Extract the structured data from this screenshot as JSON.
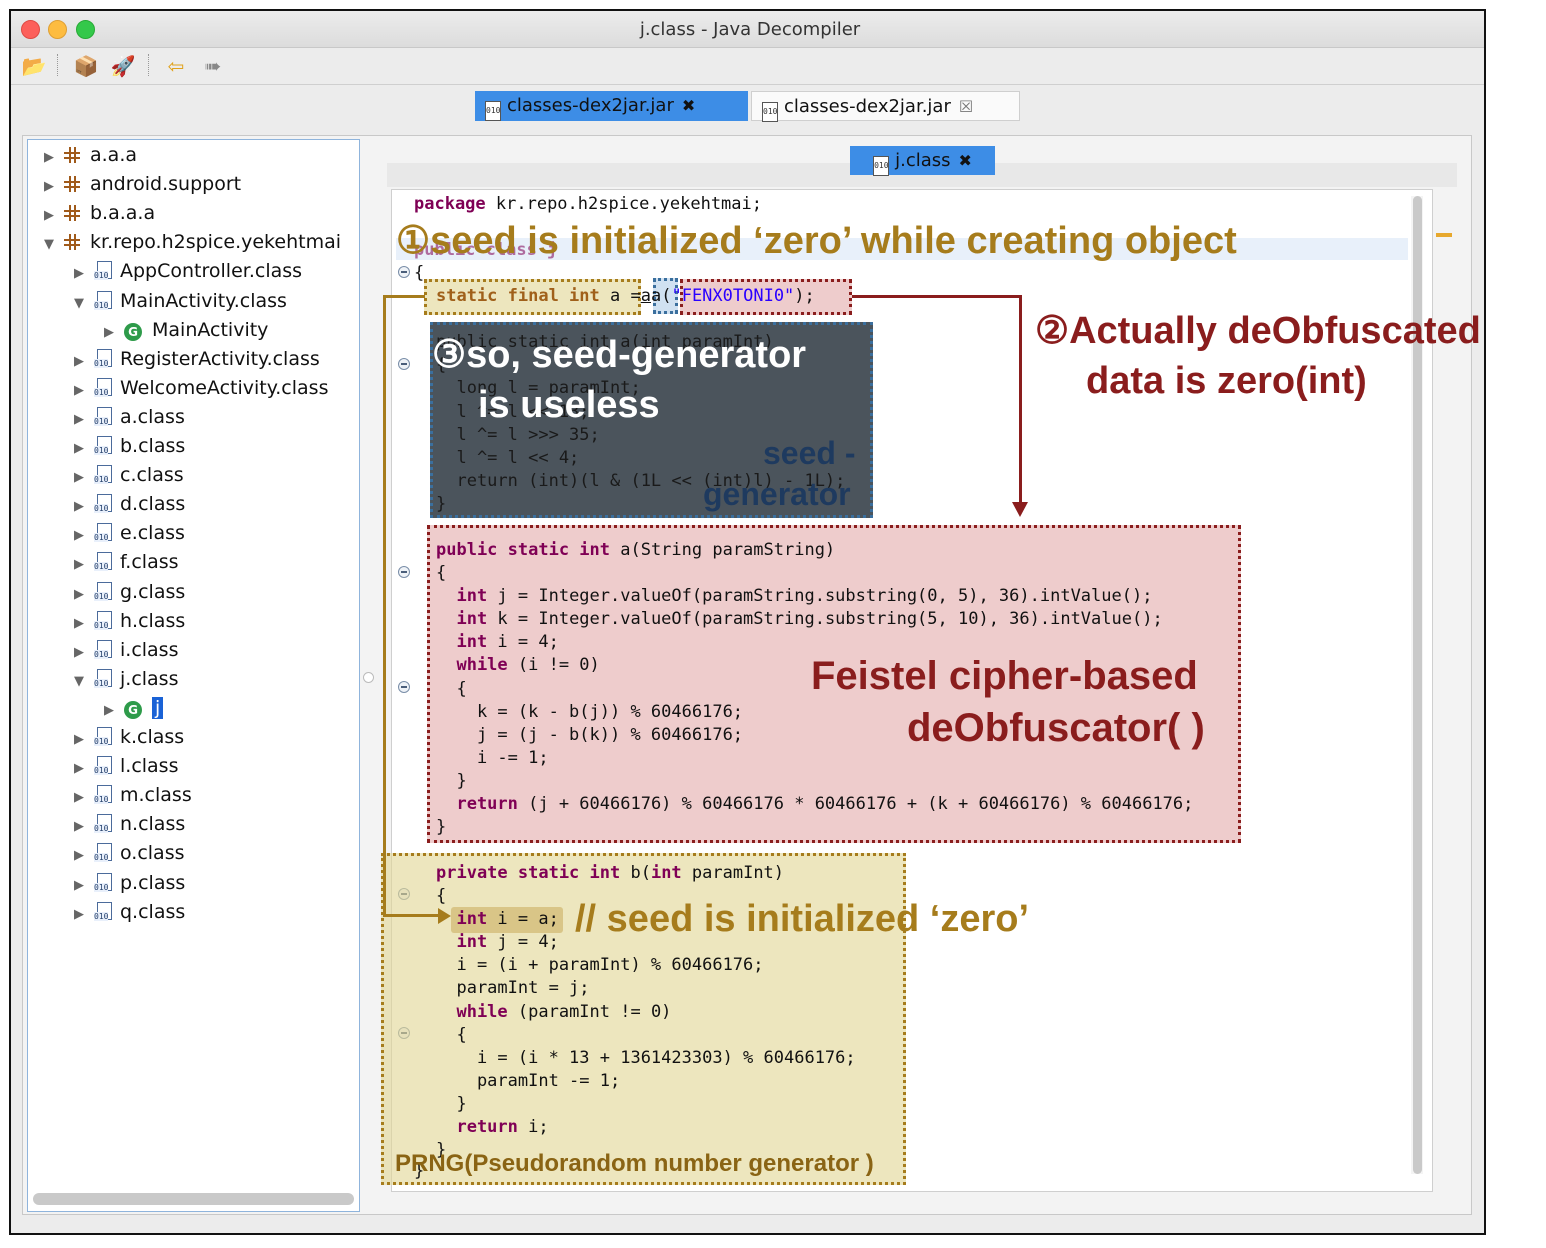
{
  "window": {
    "title": "j.class - Java Decompiler"
  },
  "toolbar": {
    "icons": [
      "open-folder-icon",
      "open-type-icon",
      "rocket-icon",
      "back-arrow-icon",
      "forward-arrow-icon"
    ]
  },
  "jar_tabs": [
    {
      "label": "classes-dex2jar.jar",
      "active": true,
      "close": "✖"
    },
    {
      "label": "classes-dex2jar.jar",
      "active": false,
      "close": "☒"
    }
  ],
  "tree": {
    "items": [
      {
        "label": "a.a.a",
        "type": "package",
        "expanded": false
      },
      {
        "label": "android.support",
        "type": "package",
        "expanded": false
      },
      {
        "label": "b.a.a.a",
        "type": "package",
        "expanded": false
      },
      {
        "label": "kr.repo.h2spice.yekehtmai",
        "type": "package",
        "expanded": true
      },
      {
        "label": "AppController.class",
        "type": "class",
        "expanded": false
      },
      {
        "label": "MainActivity.class",
        "type": "class",
        "expanded": true
      },
      {
        "label": "MainActivity",
        "type": "type",
        "expanded": false
      },
      {
        "label": "RegisterActivity.class",
        "type": "class",
        "expanded": false
      },
      {
        "label": "WelcomeActivity.class",
        "type": "class",
        "expanded": false
      },
      {
        "label": "a.class",
        "type": "class",
        "expanded": false
      },
      {
        "label": "b.class",
        "type": "class",
        "expanded": false
      },
      {
        "label": "c.class",
        "type": "class",
        "expanded": false
      },
      {
        "label": "d.class",
        "type": "class",
        "expanded": false
      },
      {
        "label": "e.class",
        "type": "class",
        "expanded": false
      },
      {
        "label": "f.class",
        "type": "class",
        "expanded": false
      },
      {
        "label": "g.class",
        "type": "class",
        "expanded": false
      },
      {
        "label": "h.class",
        "type": "class",
        "expanded": false
      },
      {
        "label": "i.class",
        "type": "class",
        "expanded": false
      },
      {
        "label": "j.class",
        "type": "class",
        "expanded": true
      },
      {
        "label": "j",
        "type": "type",
        "expanded": false,
        "selected": true
      },
      {
        "label": "k.class",
        "type": "class",
        "expanded": false
      },
      {
        "label": "l.class",
        "type": "class",
        "expanded": false
      },
      {
        "label": "m.class",
        "type": "class",
        "expanded": false
      },
      {
        "label": "n.class",
        "type": "class",
        "expanded": false
      },
      {
        "label": "o.class",
        "type": "class",
        "expanded": false
      },
      {
        "label": "p.class",
        "type": "class",
        "expanded": false
      },
      {
        "label": "q.class",
        "type": "class",
        "expanded": false
      }
    ]
  },
  "editor_tab": {
    "label": "j.class",
    "close": "✖"
  },
  "code": {
    "package_kw": "package",
    "package_name": " kr.repo.h2spice.yekehtmai;",
    "class_decl": "public class j",
    "open_brace": "{",
    "field_kw": "static final int",
    "field_name": " a ",
    "field_eq": "=",
    "field_call_a": "a",
    "field_call_rest": "a(",
    "field_string": "\"FENX0TONI0\"",
    "field_end": ");",
    "seedgen": [
      "public static int a(int paramInt)",
      "{",
      "  long l = paramInt;",
      "  l ^= l << 13;",
      "  l ^= l >>> 35;",
      "  l ^= l << 4;",
      "  return (int)(l & (1L << (int)l) - 1L);",
      "}"
    ],
    "deobf_sig_kw": "public static int",
    "deobf_sig_rest": " a(String paramString)",
    "deobf_lines": [
      {
        "kw": "",
        "text": "{"
      },
      {
        "kw": "  int",
        "text": " j = Integer.valueOf(paramString.substring(0, 5), 36).intValue();"
      },
      {
        "kw": "  int",
        "text": " k = Integer.valueOf(paramString.substring(5, 10), 36).intValue();"
      },
      {
        "kw": "  int",
        "text": " i = 4;"
      },
      {
        "kw": "  while",
        "text": " (i != 0)"
      },
      {
        "kw": "",
        "text": "  {"
      },
      {
        "kw": "",
        "text": "    k = (k - b(j)) % 60466176;"
      },
      {
        "kw": "",
        "text": "    j = (j - b(k)) % 60466176;"
      },
      {
        "kw": "",
        "text": "    i -= 1;"
      },
      {
        "kw": "",
        "text": "  }"
      },
      {
        "kw": "  return",
        "text": " (j + 60466176) % 60466176 * 60466176 + (k + 60466176) % 60466176;"
      },
      {
        "kw": "",
        "text": "}"
      }
    ],
    "prng_sig_kw": "private static int",
    "prng_sig_mid": " b(",
    "prng_sig_kw2": "int",
    "prng_sig_rest": " paramInt)",
    "prng_lines": [
      {
        "kw": "",
        "text": "{"
      },
      {
        "kw": "  int",
        "text": " i = a;"
      },
      {
        "kw": "  int",
        "text": " j = 4;"
      },
      {
        "kw": "",
        "text": "  i = (i + paramInt) % 60466176;"
      },
      {
        "kw": "",
        "text": "  paramInt = j;"
      },
      {
        "kw": "  while",
        "text": " (paramInt != 0)"
      },
      {
        "kw": "",
        "text": "  {"
      },
      {
        "kw": "",
        "text": "    i = (i * 13 + 1361423303) % 60466176;"
      },
      {
        "kw": "",
        "text": "    paramInt -= 1;"
      },
      {
        "kw": "",
        "text": "  }"
      },
      {
        "kw": "  return",
        "text": " i;"
      },
      {
        "kw": "",
        "text": "}"
      }
    ],
    "closing_brace": "}"
  },
  "annotations": {
    "note1": "①seed is initialized ‘zero’ while creating object",
    "note2_line1": "②Actually deObfuscated",
    "note2_line2": "data is zero(int)",
    "note3_line1": "③so, seed-generator",
    "note3_line2": "is useless",
    "seed_generator_line1": "seed -",
    "seed_generator_line2": "generator",
    "feistel_line1": "Feistel cipher-based",
    "feistel_line2": "deObfuscator( )",
    "seed_zero_comment": "// seed is initialized ‘zero’",
    "prng_label": "PRNG(Pseudorandom number generator )"
  },
  "colors": {
    "note_gold": "#a67c1c",
    "note_red": "#8a1d1d",
    "note_blue": "#1e3a5f",
    "tab_blue": "#3d8de6"
  }
}
